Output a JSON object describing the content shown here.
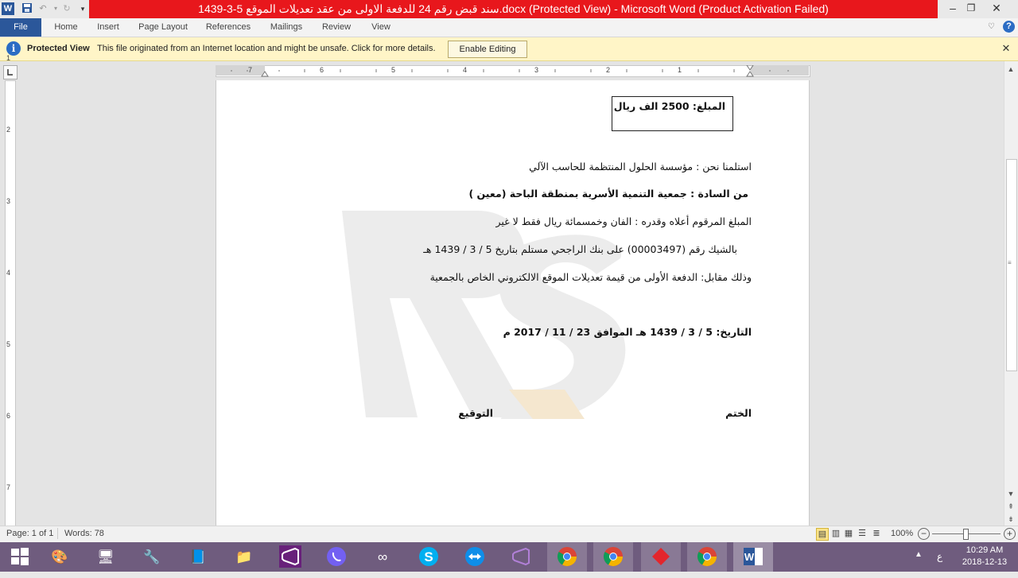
{
  "titlebar": {
    "title": "سند قبض رقم 24 للدفعة الاولى من عقد تعديلات الموقع 5-3-1439.docx (Protected View)  -  Microsoft Word (Product Activation Failed)",
    "word_icon": "W",
    "accent": "#e8171c"
  },
  "ribbon": {
    "tabs": [
      "File",
      "Home",
      "Insert",
      "Page Layout",
      "References",
      "Mailings",
      "Review",
      "View"
    ],
    "file_color": "#2b579a"
  },
  "protected_view": {
    "title": "Protected View",
    "message": "This file originated from an Internet location and might be unsafe. Click for more details.",
    "button": "Enable Editing",
    "icon": "i"
  },
  "ruler": {
    "h_numbers": [
      "7",
      "6",
      "5",
      "4",
      "3",
      "2",
      "1"
    ],
    "v_numbers": [
      "1",
      "2",
      "3",
      "4",
      "5",
      "6",
      "7"
    ]
  },
  "document": {
    "amount_box": "المبلغ: 2500 الف ريال",
    "line1": "استلمنا نحن : مؤسسة الحلول المنتظمة للحاسب الآلي",
    "line2": "من السادة : جمعية التنمية الأسرية بمنطقة الباحة (معين )",
    "line3": "المبلغ المرقوم أعلاه وقدره : الفان وخمسمائة ريال فقط لا غير",
    "line4": "بالشيك رقم (00003497) على بنك الراجحي مستلم بتاريخ  5 / 3 / 1439 هـ",
    "line5": "وذلك مقابل: الدفعة الأولى من قيمة تعديلات الموقع الالكتروني الخاص بالجمعية",
    "line6": "التاريخ: 5 / 3 / 1439 هـ  الموافق 23 / 11 / 2017 م",
    "stamp": "الختم",
    "signature": "التوقيع",
    "watermark": "RS"
  },
  "statusbar": {
    "page": "Page: 1 of 1",
    "words": "Words: 78",
    "zoom": "100%"
  },
  "taskbar": {
    "time": "10:29 AM",
    "date": "2018-12-13",
    "lang": "ع",
    "bg": "#6f5c7e"
  }
}
